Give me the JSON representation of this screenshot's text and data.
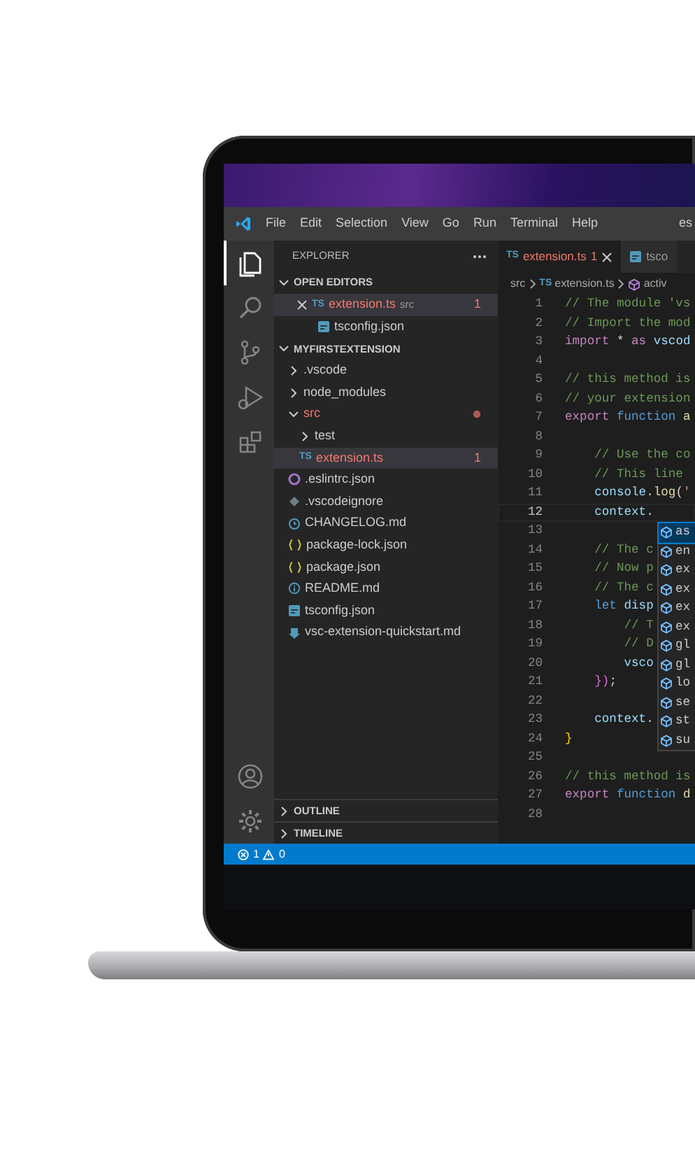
{
  "titlebar": {
    "menu": [
      "File",
      "Edit",
      "Selection",
      "View",
      "Go",
      "Run",
      "Terminal",
      "Help"
    ],
    "window_title": "es"
  },
  "activity_bar": {
    "top": [
      {
        "kind": "files",
        "selected": true
      },
      {
        "kind": "search",
        "selected": false
      },
      {
        "kind": "source-control",
        "selected": false
      },
      {
        "kind": "run-debug",
        "selected": false
      },
      {
        "kind": "extensions",
        "selected": false
      }
    ],
    "bottom": [
      {
        "kind": "account"
      },
      {
        "kind": "settings"
      }
    ]
  },
  "sidebar": {
    "title": "EXPLORER",
    "open_editors": {
      "title": "OPEN EDITORS",
      "expanded": true,
      "items": [
        {
          "name": "extension.ts",
          "kind": "ts",
          "badge": "TS",
          "folder": "src",
          "problems": "1",
          "error": true,
          "selected": true
        },
        {
          "name": "tsconfig.json",
          "kind": "tsconfig",
          "error": false,
          "selected": false
        }
      ]
    },
    "project": {
      "title": "MYFIRSTEXTENSION",
      "expanded": true,
      "children": [
        {
          "name": ".vscode",
          "kind": "folder",
          "expanded": false,
          "error": false,
          "selected": false
        },
        {
          "name": "node_modules",
          "kind": "folder",
          "expanded": false,
          "error": false,
          "selected": false
        },
        {
          "name": "src",
          "kind": "folder",
          "expanded": true,
          "error": true,
          "selected": false,
          "children": [
            {
              "name": "test",
              "kind": "folder",
              "expanded": false,
              "error": false,
              "selected": false
            },
            {
              "name": "extension.ts",
              "kind": "ts",
              "badge": "TS",
              "problems": "1",
              "error": true,
              "selected": true
            }
          ]
        },
        {
          "name": ".eslintrc.json",
          "kind": "eslint",
          "error": false,
          "selected": false
        },
        {
          "name": ".vscodeignore",
          "kind": "ignore",
          "error": false,
          "selected": false
        },
        {
          "name": "CHANGELOG.md",
          "kind": "changelog",
          "error": false,
          "selected": false
        },
        {
          "name": "package-lock.json",
          "kind": "json",
          "error": false,
          "selected": false
        },
        {
          "name": "package.json",
          "kind": "json",
          "error": false,
          "selected": false
        },
        {
          "name": "README.md",
          "kind": "readme",
          "error": false,
          "selected": false
        },
        {
          "name": "tsconfig.json",
          "kind": "tsconfig",
          "error": false,
          "selected": false
        },
        {
          "name": "vsc-extension-quickstart.md",
          "kind": "markdown",
          "error": false,
          "selected": false
        }
      ]
    },
    "panels": [
      {
        "title": "OUTLINE",
        "expanded": false
      },
      {
        "title": "TIMELINE",
        "expanded": false
      }
    ]
  },
  "editor": {
    "tabs": [
      {
        "label": "extension.ts",
        "kind": "ts",
        "badge": "TS",
        "problems": "1",
        "error": true,
        "selected": true
      },
      {
        "label": "tsco",
        "kind": "tsconfig",
        "error": false,
        "selected": false
      }
    ],
    "breadcrumb": [
      {
        "text": "src",
        "kind": "folder"
      },
      {
        "text": "extension.ts",
        "kind": "ts",
        "badge": "TS"
      },
      {
        "text": "activ",
        "kind": "symbol"
      }
    ],
    "lines": [
      {
        "number": "1",
        "current": false,
        "tokens": [
          {
            "kind": "comment",
            "text": "// The module 'vs"
          }
        ]
      },
      {
        "number": "2",
        "current": false,
        "tokens": [
          {
            "kind": "comment",
            "text": "// Import the mod"
          }
        ]
      },
      {
        "number": "3",
        "current": false,
        "tokens": [
          {
            "kind": "control",
            "text": "import"
          },
          {
            "kind": "plain",
            "text": " * "
          },
          {
            "kind": "control",
            "text": "as"
          },
          {
            "kind": "variable",
            "text": " vscod"
          }
        ]
      },
      {
        "number": "4",
        "current": false
      },
      {
        "number": "5",
        "current": false,
        "tokens": [
          {
            "kind": "comment",
            "text": "// this method is"
          }
        ]
      },
      {
        "number": "6",
        "current": false,
        "tokens": [
          {
            "kind": "comment",
            "text": "// your extension"
          }
        ]
      },
      {
        "number": "7",
        "current": false,
        "tokens": [
          {
            "kind": "control",
            "text": "export"
          },
          {
            "kind": "keyword",
            "text": " function"
          },
          {
            "kind": "function",
            "text": " a"
          }
        ]
      },
      {
        "number": "8",
        "current": false
      },
      {
        "number": "9",
        "current": false,
        "tokens": [
          {
            "kind": "comment",
            "text": "    // Use the co"
          }
        ]
      },
      {
        "number": "10",
        "current": false,
        "tokens": [
          {
            "kind": "comment",
            "text": "    // This line "
          }
        ]
      },
      {
        "number": "11",
        "current": false,
        "tokens": [
          {
            "kind": "variable",
            "text": "    console"
          },
          {
            "kind": "plain",
            "text": "."
          },
          {
            "kind": "function",
            "text": "log"
          },
          {
            "kind": "plain",
            "text": "("
          },
          {
            "kind": "string",
            "text": "'"
          }
        ]
      },
      {
        "number": "12",
        "current": true,
        "tokens": [
          {
            "kind": "variable",
            "text": "    context"
          },
          {
            "kind": "plain",
            "text": "."
          }
        ]
      },
      {
        "number": "13",
        "current": false
      },
      {
        "number": "14",
        "current": false,
        "tokens": [
          {
            "kind": "comment",
            "text": "    // The c"
          }
        ]
      },
      {
        "number": "15",
        "current": false,
        "tokens": [
          {
            "kind": "comment",
            "text": "    // Now p"
          }
        ]
      },
      {
        "number": "16",
        "current": false,
        "tokens": [
          {
            "kind": "comment",
            "text": "    // The c"
          }
        ]
      },
      {
        "number": "17",
        "current": false,
        "tokens": [
          {
            "kind": "keyword",
            "text": "    let"
          },
          {
            "kind": "variable",
            "text": " disp"
          }
        ]
      },
      {
        "number": "18",
        "current": false,
        "tokens": [
          {
            "kind": "comment",
            "text": "        // T"
          }
        ]
      },
      {
        "number": "19",
        "current": false,
        "tokens": [
          {
            "kind": "comment",
            "text": "        // D"
          }
        ]
      },
      {
        "number": "20",
        "current": false,
        "tokens": [
          {
            "kind": "variable",
            "text": "        vsco"
          }
        ]
      },
      {
        "number": "21",
        "current": false,
        "tokens": [
          {
            "kind": "bracket",
            "text": "    })"
          },
          {
            "kind": "plain",
            "text": ";"
          }
        ]
      },
      {
        "number": "22",
        "current": false
      },
      {
        "number": "23",
        "current": false,
        "tokens": [
          {
            "kind": "variable",
            "text": "    context"
          },
          {
            "kind": "plain",
            "text": "."
          }
        ]
      },
      {
        "number": "24",
        "current": false,
        "tokens": [
          {
            "kind": "brace",
            "text": "}"
          }
        ]
      },
      {
        "number": "25",
        "current": false
      },
      {
        "number": "26",
        "current": false,
        "tokens": [
          {
            "kind": "comment",
            "text": "// this method is"
          }
        ]
      },
      {
        "number": "27",
        "current": false,
        "tokens": [
          {
            "kind": "control",
            "text": "export"
          },
          {
            "kind": "keyword",
            "text": " function"
          },
          {
            "kind": "function",
            "text": " d"
          }
        ]
      },
      {
        "number": "28",
        "current": false
      }
    ],
    "suggestions": [
      {
        "label": "as",
        "selected": true
      },
      {
        "label": "en",
        "selected": false
      },
      {
        "label": "ex",
        "selected": false
      },
      {
        "label": "ex",
        "selected": false
      },
      {
        "label": "ex",
        "selected": false
      },
      {
        "label": "ex",
        "selected": false
      },
      {
        "label": "gl",
        "selected": false
      },
      {
        "label": "gl",
        "selected": false
      },
      {
        "label": "lo",
        "selected": false
      },
      {
        "label": "se",
        "selected": false
      },
      {
        "label": "st",
        "selected": false
      },
      {
        "label": "su",
        "selected": false
      }
    ]
  },
  "status_bar": {
    "errors": "1",
    "warnings": "0"
  }
}
